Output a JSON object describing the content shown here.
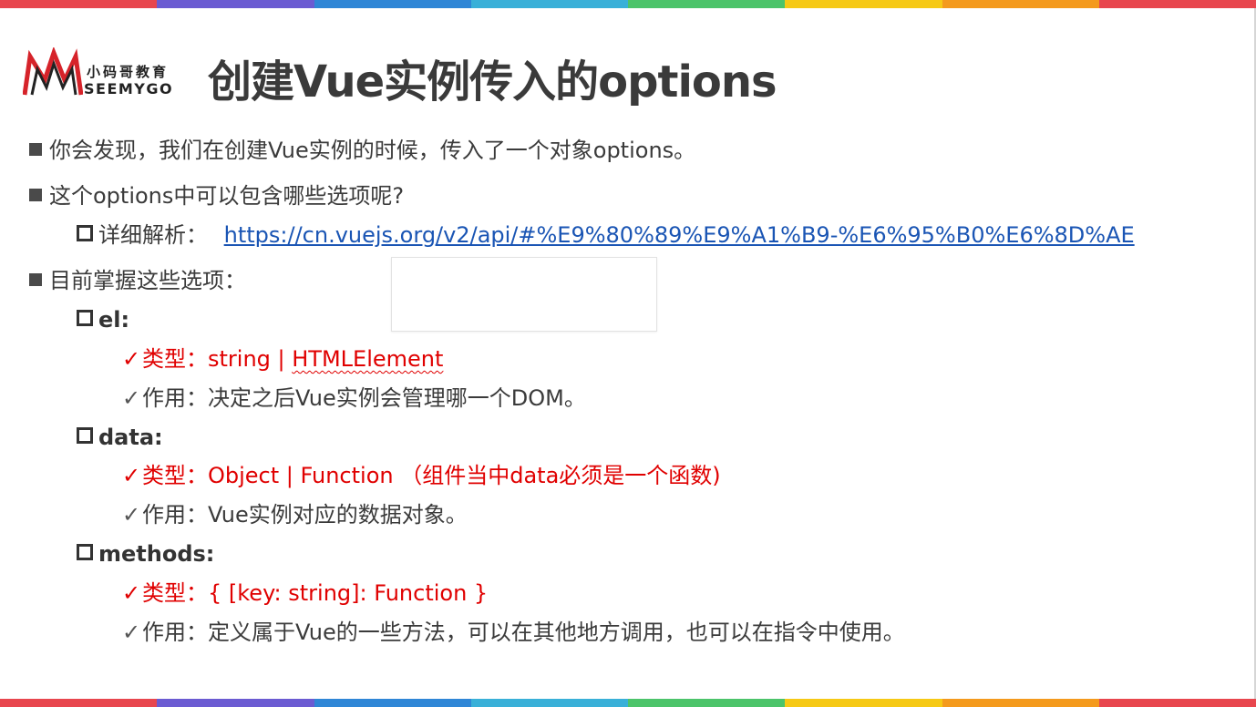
{
  "header": {
    "title": "创建Vue实例传入的options",
    "logo_cn": "小码哥教育",
    "logo_en": "SEEMYGO"
  },
  "colors": {
    "stripes": [
      "#e8464e",
      "#6b5bd2",
      "#2f86d6",
      "#39b0d8",
      "#4cc46a",
      "#f6c915",
      "#f49a1d",
      "#e8464e"
    ]
  },
  "items": [
    {
      "text": "你会发现，我们在创建Vue实例的时候，传入了一个对象options。"
    },
    {
      "text": "这个options中可以包含哪些选项呢?"
    },
    {
      "label": "详细解析：",
      "link": "https://cn.vuejs.org/v2/api/#%E9%80%89%E9%A1%B9-%E6%95%B0%E6%8D%AE"
    },
    {
      "text": "目前掌握这些选项："
    }
  ],
  "options": {
    "el": {
      "name": "el:",
      "type_label": "类型：",
      "type_value_a": "string | ",
      "type_value_b": "HTMLElement",
      "use": "作用：决定之后Vue实例会管理哪一个DOM。"
    },
    "data": {
      "name": "data:",
      "type": "类型：Object | Function （组件当中data必须是一个函数)",
      "use": "作用：Vue实例对应的数据对象。"
    },
    "methods": {
      "name": "methods:",
      "type": "类型：{ [key: string]: Function }",
      "use": "作用：定义属于Vue的一些方法，可以在其他地方调用，也可以在指令中使用。"
    }
  },
  "icons": {
    "check": "✓"
  }
}
